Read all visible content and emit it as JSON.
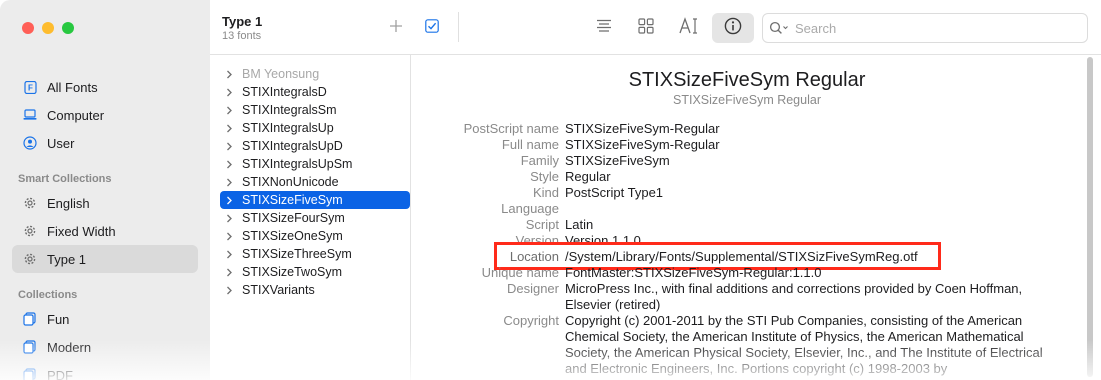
{
  "sidebar": {
    "items": [
      {
        "label": "All Fonts",
        "icon": "font-book-icon"
      },
      {
        "label": "Computer",
        "icon": "computer-icon"
      },
      {
        "label": "User",
        "icon": "user-icon"
      }
    ],
    "smart_header": "Smart Collections",
    "smart_items": [
      {
        "label": "English",
        "icon": "gear-icon"
      },
      {
        "label": "Fixed Width",
        "icon": "gear-icon"
      },
      {
        "label": "Type 1",
        "icon": "gear-icon",
        "selected": true
      }
    ],
    "collections_header": "Collections",
    "collection_items": [
      {
        "label": "Fun",
        "icon": "collection-icon"
      },
      {
        "label": "Modern",
        "icon": "collection-icon"
      },
      {
        "label": "PDF",
        "icon": "collection-icon"
      }
    ]
  },
  "toolbar": {
    "title": "Type 1",
    "subtitle": "13 fonts",
    "search_placeholder": "Search"
  },
  "fonts": [
    {
      "name": "BM Yeonsung",
      "dim": true
    },
    {
      "name": "STIXIntegralsD"
    },
    {
      "name": "STIXIntegralsSm"
    },
    {
      "name": "STIXIntegralsUp"
    },
    {
      "name": "STIXIntegralsUpD"
    },
    {
      "name": "STIXIntegralsUpSm"
    },
    {
      "name": "STIXNonUnicode"
    },
    {
      "name": "STIXSizeFiveSym",
      "selected": true
    },
    {
      "name": "STIXSizeFourSym"
    },
    {
      "name": "STIXSizeOneSym"
    },
    {
      "name": "STIXSizeThreeSym"
    },
    {
      "name": "STIXSizeTwoSym"
    },
    {
      "name": "STIXVariants"
    }
  ],
  "detail": {
    "title": "STIXSizeFiveSym Regular",
    "subtitle": "STIXSizeFiveSym Regular",
    "fields": [
      {
        "key": "PostScript name",
        "value": "STIXSizeFiveSym-Regular"
      },
      {
        "key": "Full name",
        "value": "STIXSizeFiveSym-Regular"
      },
      {
        "key": "Family",
        "value": "STIXSizeFiveSym"
      },
      {
        "key": "Style",
        "value": "Regular"
      },
      {
        "key": "Kind",
        "value": "PostScript Type1"
      },
      {
        "key": "Language",
        "value": ""
      },
      {
        "key": "Script",
        "value": "Latin"
      },
      {
        "key": "Version",
        "value": "Version 1.1.0"
      },
      {
        "key": "Location",
        "value": "/System/Library/Fonts/Supplemental/STIXSizFiveSymReg.otf"
      },
      {
        "key": "Unique name",
        "value": "FontMaster:STIXSizeFiveSym-Regular:1.1.0"
      },
      {
        "key": "Designer",
        "value": "MicroPress Inc., with final additions and corrections provided by Coen Hoffman, Elsevier (retired)"
      },
      {
        "key": "Copyright",
        "value": "Copyright (c) 2001-2011 by the STI Pub Companies, consisting of the American Chemical Society, the American Institute of Physics, the American Mathematical Society, the American Physical Society, Elsevier, Inc., and The Institute of Electrical and Electronic Engineers, Inc. Portions copyright (c) 1998-2003 by"
      }
    ]
  },
  "colors": {
    "accent": "#0b63e5",
    "highlight_border": "#ff2a1a",
    "sidebar_bg": "#ececec"
  }
}
